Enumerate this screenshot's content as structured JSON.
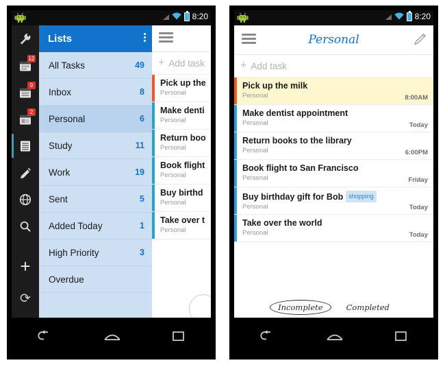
{
  "statusbar": {
    "clock": "8:20",
    "icons": [
      "android-robot-icon",
      "signal-icon",
      "wifi-icon",
      "battery-icon"
    ]
  },
  "left_phone": {
    "rail": {
      "items": [
        {
          "name": "wrench-icon",
          "badge": ""
        },
        {
          "name": "calendar-icon",
          "badge": "12"
        },
        {
          "name": "calendar-icon",
          "badge": "9"
        },
        {
          "name": "calendar-icon",
          "badge": "2"
        },
        {
          "name": "tasks-icon",
          "badge": "",
          "selected": true
        },
        {
          "name": "notes-icon",
          "badge": ""
        },
        {
          "name": "globe-icon",
          "badge": ""
        },
        {
          "name": "search-icon",
          "badge": ""
        }
      ],
      "add_label": "+",
      "sync_label": "⟳"
    },
    "drawer": {
      "title": "Lists",
      "menu_icon": "overflow-menu-icon",
      "rows": [
        {
          "label": "All Tasks",
          "count": "49",
          "active": false
        },
        {
          "label": "Inbox",
          "count": "8",
          "active": false
        },
        {
          "label": "Personal",
          "count": "6",
          "active": true
        },
        {
          "label": "Study",
          "count": "11",
          "active": false
        },
        {
          "label": "Work",
          "count": "19",
          "active": false
        },
        {
          "label": "Sent",
          "count": "5",
          "active": false
        },
        {
          "label": "Added Today",
          "count": "1",
          "active": false
        },
        {
          "label": "High Priority",
          "count": "3",
          "active": false
        },
        {
          "label": "Overdue",
          "count": "",
          "active": false
        }
      ]
    },
    "peek": {
      "menu_icon": "hamburger-icon",
      "add_task": "Add task",
      "add_task_plus": "+",
      "tasks": [
        {
          "title": "Pick up the",
          "list": "Personal",
          "accent": true
        },
        {
          "title": "Make denti",
          "list": "Personal",
          "accent": false
        },
        {
          "title": "Return boo",
          "list": "Personal",
          "accent": false
        },
        {
          "title": "Book flight",
          "list": "Personal",
          "accent": false
        },
        {
          "title": "Buy birthd",
          "list": "Personal",
          "accent": false
        },
        {
          "title": "Take over t",
          "list": "Personal",
          "accent": false
        }
      ]
    }
  },
  "right_phone": {
    "header": {
      "menu_icon": "hamburger-icon",
      "title": "Personal",
      "edit_icon": "pencil-icon"
    },
    "add_task": "Add task",
    "add_task_plus": "+",
    "tasks": [
      {
        "title": "Pick up the milk",
        "list": "Personal",
        "when": "8:00AM",
        "highlight": true,
        "tag": ""
      },
      {
        "title": "Make dentist appointment",
        "list": "Personal",
        "when": "Today",
        "highlight": false,
        "tag": ""
      },
      {
        "title": "Return books to the library",
        "list": "Personal",
        "when": "6:00PM",
        "highlight": false,
        "tag": ""
      },
      {
        "title": "Book flight to San Francisco",
        "list": "Personal",
        "when": "Friday",
        "highlight": false,
        "tag": ""
      },
      {
        "title": "Buy birthday gift for Bob",
        "list": "Personal",
        "when": "Today",
        "highlight": false,
        "tag": "shopping"
      },
      {
        "title": "Take over the world",
        "list": "Personal",
        "when": "Today",
        "highlight": false,
        "tag": ""
      }
    ],
    "tabs": [
      {
        "label": "Incomplete",
        "selected": true
      },
      {
        "label": "Completed",
        "selected": false
      }
    ]
  },
  "navbar": {
    "buttons": [
      "back-icon",
      "home-icon",
      "recents-icon"
    ]
  },
  "colors": {
    "accent_blue": "#1273cd",
    "rail_blue": "#2e9fd4",
    "orange": "#f0592b",
    "badge_red": "#d9342b",
    "highlight_yellow": "#fdf6cf",
    "tag_blue": "#cfe5f6"
  }
}
